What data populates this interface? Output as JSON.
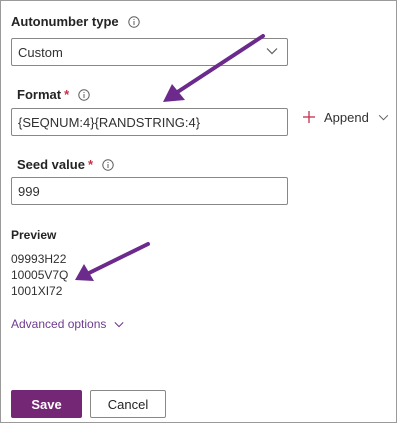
{
  "autonumber_type": {
    "label": "Autonumber type",
    "value": "Custom"
  },
  "format": {
    "label": "Format",
    "required_mark": "*",
    "value": "{SEQNUM:4}{RANDSTRING:4}"
  },
  "append": {
    "label": "Append"
  },
  "seed_value": {
    "label": "Seed value",
    "required_mark": "*",
    "value": "999"
  },
  "preview": {
    "title": "Preview",
    "items": [
      "09993H22",
      "10005V7Q",
      "1001XI72"
    ]
  },
  "advanced_options": {
    "label": "Advanced options"
  },
  "actions": {
    "save_label": "Save",
    "cancel_label": "Cancel"
  },
  "colors": {
    "accent": "#742774",
    "annotation_arrow": "#6b2a8c",
    "required": "#c4314b"
  },
  "icons": [
    "info-icon",
    "chevron-down-icon",
    "plus-icon",
    "arrow-annotation"
  ]
}
